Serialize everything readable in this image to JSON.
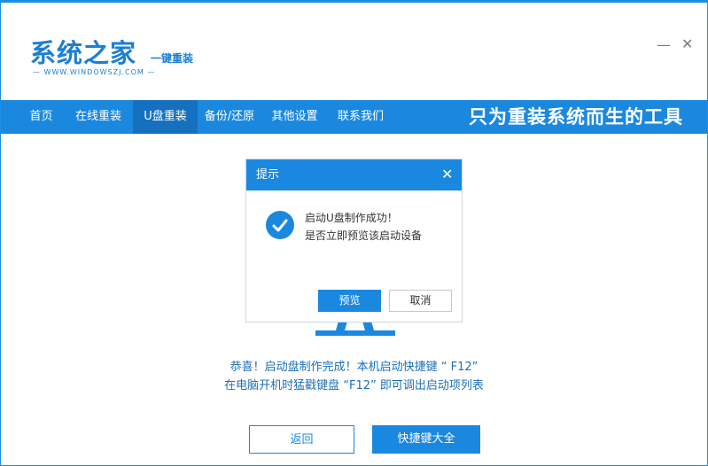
{
  "app": {
    "logo_text": "系统之家",
    "logo_subtitle": "一键重装",
    "logo_url": "— WWW.WINDOWSZJ.COM —",
    "minimize_symbol": "—",
    "close_symbol": "✕"
  },
  "nav": {
    "items": [
      {
        "label": "首页"
      },
      {
        "label": "在线重装"
      },
      {
        "label": "U盘重装"
      },
      {
        "label": "备份/还原"
      },
      {
        "label": "其他设置"
      },
      {
        "label": "联系我们"
      }
    ],
    "active_index": 2,
    "slogan": "只为重装系统而生的工具"
  },
  "main": {
    "message_line1": "恭喜！启动盘制作完成！本机启动快捷键 “ F12”",
    "message_line2": "在电脑开机时猛戳键盘 “F12” 即可调出启动项列表",
    "back_button": "返回",
    "hotkey_button": "快捷键大全"
  },
  "dialog": {
    "title": "提示",
    "close_symbol": "✕",
    "line1": "启动U盘制作成功！",
    "line2": "是否立即预览该启动设备",
    "preview_button": "预览",
    "cancel_button": "取消",
    "icon": "check-circle-icon"
  },
  "colors": {
    "accent": "#1b88e0",
    "accent_dark": "#1570c0",
    "text_blue": "#1b6fb8"
  }
}
